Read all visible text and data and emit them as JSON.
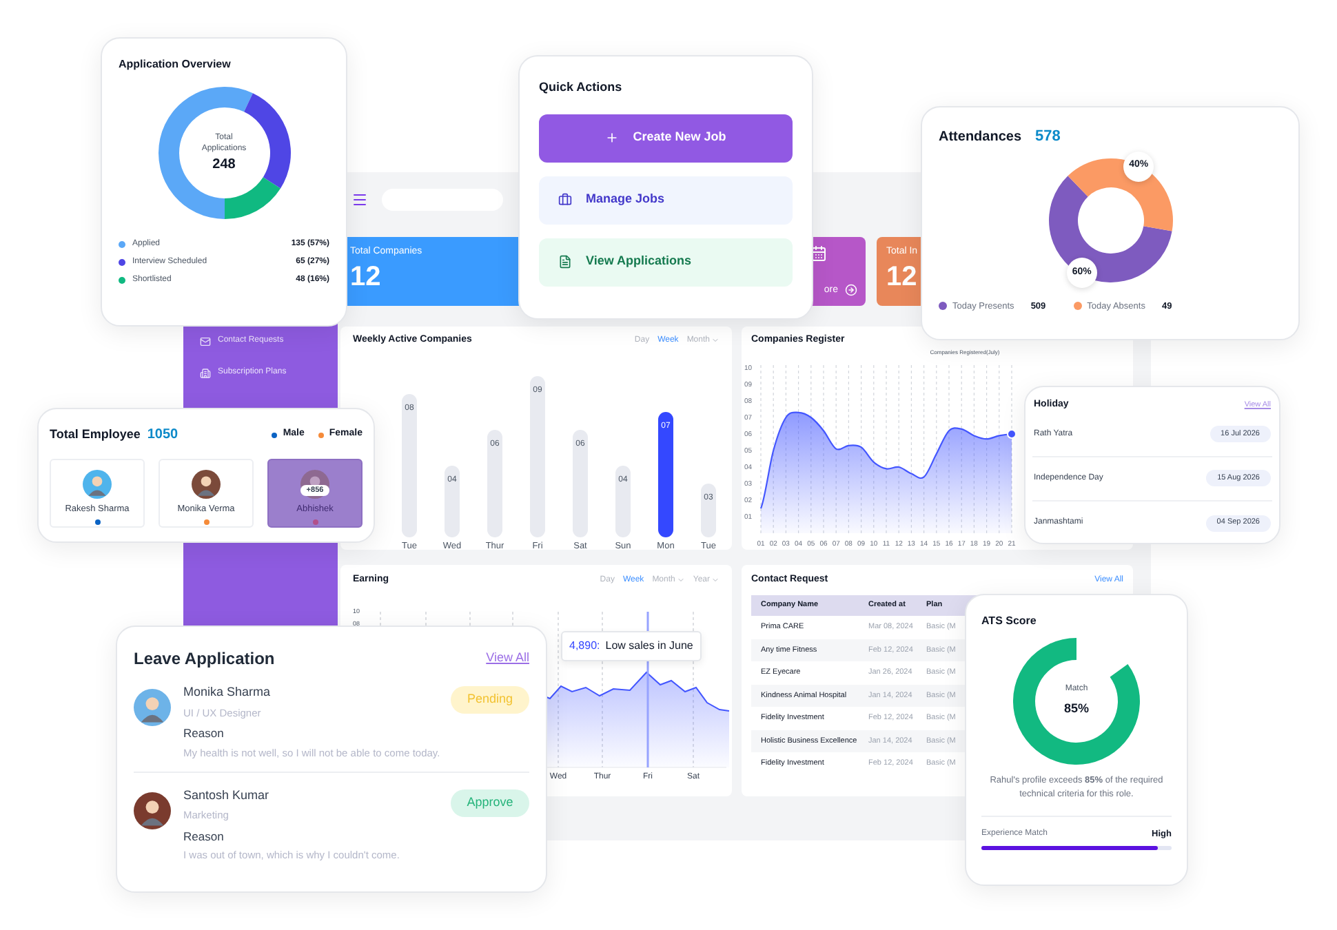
{
  "dashboard": {
    "sidebar": {
      "items": [
        {
          "label": "Contact Requests"
        },
        {
          "label": "Subscription Plans"
        }
      ]
    },
    "stat_cards": [
      {
        "kind": "stat",
        "label": "Total Companies",
        "value": "12",
        "color": "#3a9bff"
      },
      {
        "kind": "link",
        "label": "ore",
        "color": "#b657c8"
      },
      {
        "kind": "stat",
        "label": "Total In",
        "value": "12",
        "color": "#e8875a"
      }
    ],
    "weekly": {
      "title": "Weekly Active Companies",
      "filters": [
        {
          "label": "Day",
          "selected": false,
          "dropdown": false
        },
        {
          "label": "Week",
          "selected": true,
          "dropdown": false
        },
        {
          "label": "Month",
          "selected": false,
          "dropdown": true
        }
      ],
      "chart_data": {
        "type": "bar",
        "categories": [
          "Tue",
          "Wed",
          "Thur",
          "Fri",
          "Sat",
          "Sun",
          "Mon",
          "Tue"
        ],
        "stacked": true,
        "data_labels": true,
        "series": [
          {
            "color": "#e8eaf0",
            "values": [
              8,
              4,
              6,
              9,
              6,
              4,
              null,
              3
            ],
            "value_labels": [
              "08",
              "04",
              "06",
              "09",
              "06",
              "04",
              null,
              "03"
            ]
          },
          {
            "color": "#3448ff",
            "values": [
              null,
              null,
              null,
              null,
              null,
              null,
              7,
              null
            ],
            "value_labels": [
              null,
              null,
              null,
              null,
              null,
              null,
              "07",
              null
            ]
          }
        ]
      }
    },
    "register": {
      "title": "Companies Register",
      "chart_data": {
        "type": "area",
        "title": "Companies Registered(July)",
        "x": [
          "01",
          "02",
          "03",
          "04",
          "05",
          "06",
          "07",
          "08",
          "09",
          "10",
          "11",
          "12",
          "13",
          "14",
          "15",
          "16",
          "17",
          "18",
          "19",
          "20",
          "21"
        ],
        "series": [
          {
            "color": "#4356ff",
            "values": [
              1.5,
              5.0,
              7.0,
              7.3,
              7.0,
              6.2,
              5.1,
              5.3,
              5.2,
              4.3,
              3.9,
              4.0,
              3.6,
              3.4,
              4.8,
              6.2,
              6.3,
              5.9,
              5.7,
              5.9,
              6.0
            ]
          }
        ],
        "ylim": [
          0,
          10
        ],
        "grid": true,
        "yticks": [
          {
            "value": 1,
            "label": "01"
          },
          {
            "value": 2,
            "label": "02"
          },
          {
            "value": 3,
            "label": "03"
          },
          {
            "value": 4,
            "label": "04"
          },
          {
            "value": 5,
            "label": "05"
          },
          {
            "value": 6,
            "label": "06"
          },
          {
            "value": 7,
            "label": "07"
          },
          {
            "value": 8,
            "label": "08"
          },
          {
            "value": 9,
            "label": "09"
          },
          {
            "value": 10,
            "label": "10"
          }
        ]
      }
    },
    "earning": {
      "title": "Earning",
      "filters": [
        {
          "label": "Day",
          "selected": false,
          "dropdown": false
        },
        {
          "label": "Week",
          "selected": true,
          "dropdown": false
        },
        {
          "label": "Month",
          "selected": false,
          "dropdown": true
        },
        {
          "label": "Year",
          "selected": false,
          "dropdown": true
        }
      ],
      "y_labels": [
        "10",
        "08"
      ],
      "x_labels": [
        "Wed",
        "Thur",
        "Fri",
        "Sat"
      ],
      "tooltip": {
        "value": "4,890:",
        "text": "Low sales in June"
      }
    },
    "contacts": {
      "title": "Contact Request",
      "link": "View All",
      "columns": [
        "Company Name",
        "Created at",
        "Plan"
      ],
      "rows": [
        [
          "Prima CARE",
          "Mar 08, 2024",
          "Basic (M"
        ],
        [
          "Any time Fitness",
          "Feb 12, 2024",
          "Basic (M"
        ],
        [
          "EZ Eyecare",
          "Jan 26, 2024",
          "Basic (M"
        ],
        [
          "Kindness Animal Hospital",
          "Jan 14, 2024",
          "Basic (M"
        ],
        [
          "Fidelity Investment",
          "Feb 12, 2024",
          "Basic (M"
        ],
        [
          "Holistic Business Excellence",
          "Jan 14, 2024",
          "Basic (M"
        ],
        [
          "Fidelity Investment",
          "Feb 12, 2024",
          "Basic (M"
        ]
      ]
    }
  },
  "application_overview": {
    "title": "Application Overview",
    "center_label": "Total Applications",
    "center_value": "248",
    "chart_data": {
      "type": "donut",
      "categories": [
        "Applied",
        "Interview Scheduled",
        "Shortlisted"
      ],
      "values": [
        57,
        27,
        16
      ],
      "legend": "bottom"
    },
    "legend": [
      {
        "value": "135 (57%)",
        "color": "#5ba8f7"
      },
      {
        "value": "65 (27%)",
        "color": "#4f46e5"
      },
      {
        "value": "48 (16%)",
        "color": "#10b981"
      }
    ]
  },
  "quick_actions": {
    "title": "Quick Actions",
    "actions": [
      {
        "label": "Create New Job",
        "kind": "primary"
      },
      {
        "label": "Manage Jobs",
        "kind": "secondary"
      },
      {
        "label": "View Applications",
        "kind": "success"
      }
    ]
  },
  "attendances": {
    "title": "Attendances",
    "total": "578",
    "chart_data": {
      "type": "donut",
      "categories": [
        "Today Presents",
        "Today Absents"
      ],
      "values": [
        60,
        40
      ],
      "value_labels": [
        "60%",
        "40%"
      ],
      "legend": "bottom"
    },
    "legend": [
      {
        "value": "509",
        "color": "#7e5bbf"
      },
      {
        "value": "49",
        "color": "#fb9a64"
      }
    ]
  },
  "total_employee": {
    "title": "Total Employee",
    "count": "1050",
    "legend": [
      {
        "label": "Male",
        "color": "#0b63c4"
      },
      {
        "label": "Female",
        "color": "#f58b3a"
      }
    ],
    "employees": [
      {
        "kind": "person",
        "name": "Rakesh Sharma",
        "color": "#0b63c4"
      },
      {
        "kind": "person",
        "name": "Monika Verma",
        "color": "#f58b3a"
      },
      {
        "kind": "more",
        "name": "Abhishek",
        "more": "+856",
        "color": "#b2508a"
      }
    ]
  },
  "holiday": {
    "title": "Holiday",
    "link": "View All",
    "items": [
      {
        "name": "Rath Yatra",
        "date": "16 Jul 2026"
      },
      {
        "name": "Independence Day",
        "date": "15 Aug 2026"
      },
      {
        "name": "Janmashtami",
        "date": "04 Sep 2026"
      }
    ]
  },
  "leave_application": {
    "title": "Leave Application",
    "link": "View All",
    "items": [
      {
        "name": "Monika Sharma",
        "role": "UI / UX Designer",
        "reason_label": "Reason",
        "reason": "My health is not well, so I will not be able to come today.",
        "status": "Pending",
        "kind": "pending"
      },
      {
        "name": "Santosh Kumar",
        "role": "Marketing",
        "reason_label": "Reason",
        "reason": "I was out of town, which is why I couldn't come.",
        "status": "Approve",
        "kind": "approve"
      }
    ]
  },
  "ats": {
    "title": "ATS Score",
    "center_label": "Match",
    "center_value": "85%",
    "summary": "Rahul's profile exceeds **85%** of the required technical criteria for this role.",
    "meter": {
      "label": "Experience Match",
      "reading": "High",
      "level": 0.93
    }
  }
}
